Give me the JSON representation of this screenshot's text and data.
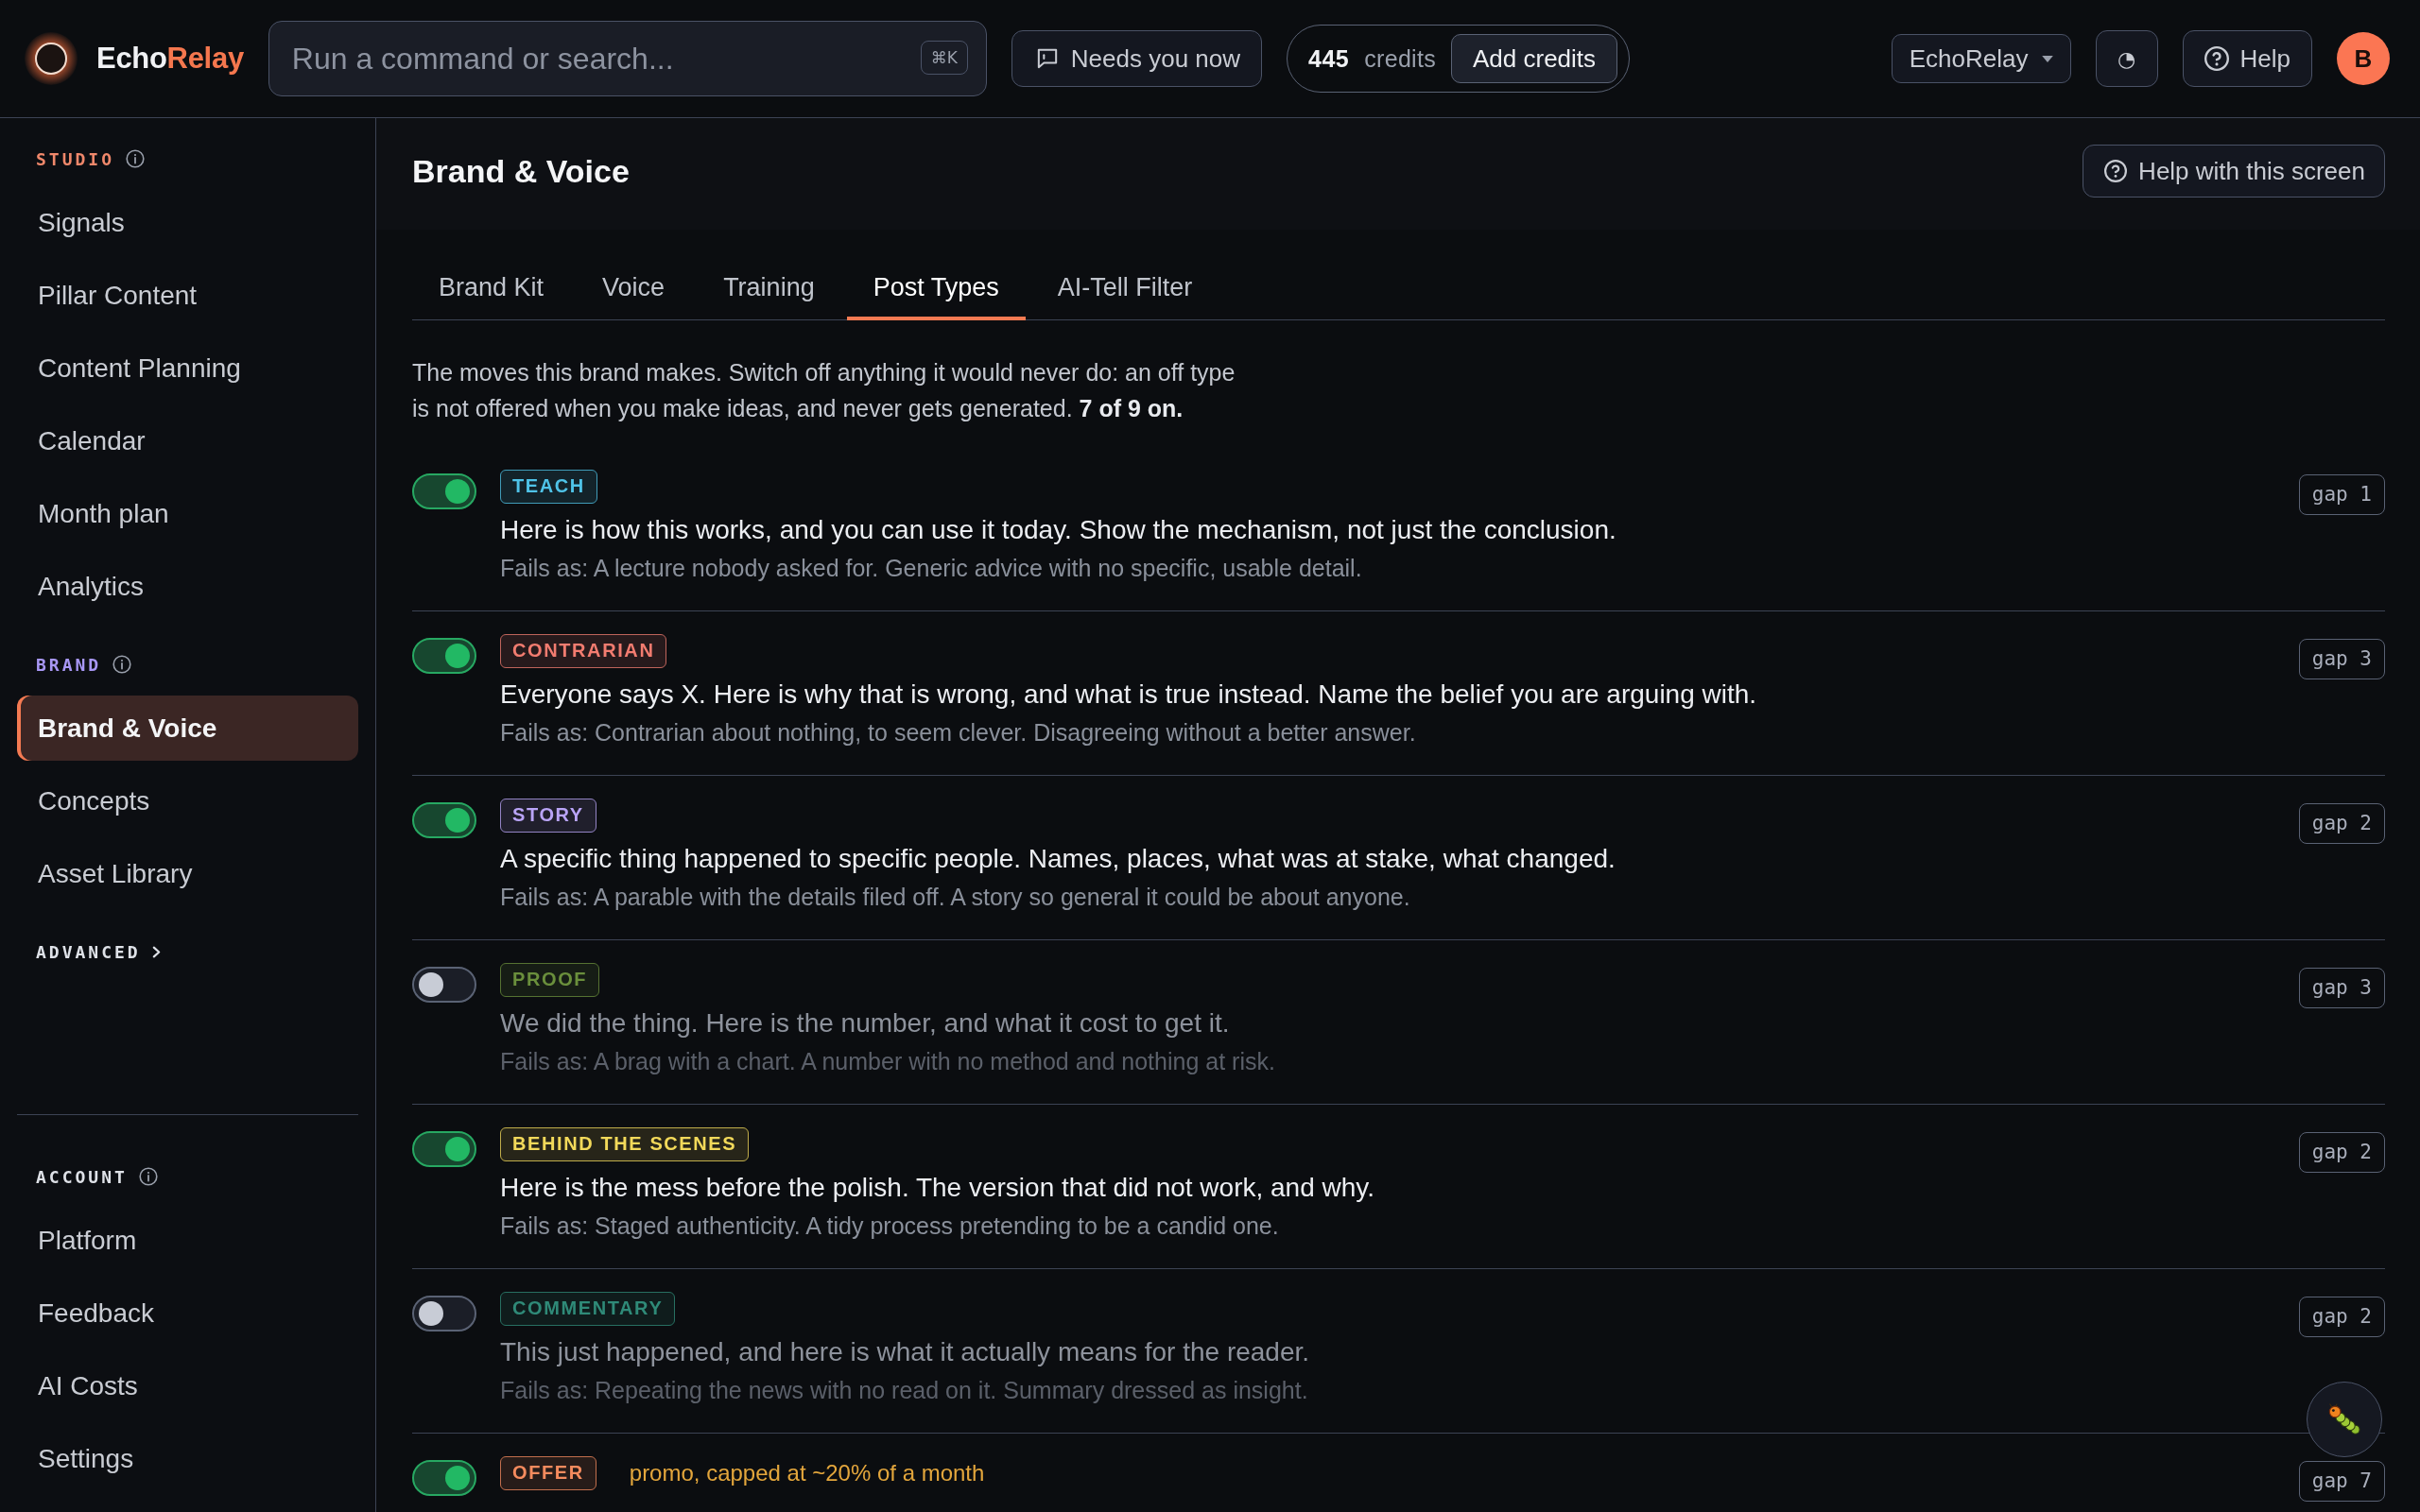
{
  "topbar": {
    "logo": {
      "name": "Echo",
      "accent": "Relay"
    },
    "search": {
      "placeholder": "Run a command or search...",
      "shortcut": "⌘K"
    },
    "needs_button": {
      "label": "Needs you now"
    },
    "credits": {
      "amount": "445",
      "unit": "credits",
      "button": "Add credits"
    },
    "workspace_select": {
      "value": "EchoRelay"
    },
    "theme_button": {
      "label": "◔"
    },
    "help_button": {
      "label": "Help"
    },
    "avatar": {
      "initial": "B"
    }
  },
  "sidebar": {
    "sections": [
      {
        "kind": "list",
        "title": "STUDIO",
        "color": "#f0886b",
        "items": [
          {
            "label": "Signals",
            "selected": false
          },
          {
            "label": "Pillar Content",
            "selected": false
          },
          {
            "label": "Content Planning",
            "selected": false
          },
          {
            "label": "Calendar",
            "selected": false
          },
          {
            "label": "Month plan",
            "selected": false
          },
          {
            "label": "Analytics",
            "selected": false
          }
        ]
      },
      {
        "kind": "list",
        "title": "BRAND",
        "color": "#a897f5",
        "items": [
          {
            "label": "Brand & Voice",
            "selected": true
          },
          {
            "label": "Concepts",
            "selected": false
          },
          {
            "label": "Asset Library",
            "selected": false
          }
        ]
      },
      {
        "kind": "collapsed",
        "title": "ADVANCED",
        "color": "#dfe2e8"
      }
    ],
    "footer_sections": [
      {
        "kind": "list",
        "title": "ACCOUNT",
        "color": "#dfe2e8",
        "items": [
          {
            "label": "Platform",
            "selected": false
          },
          {
            "label": "Feedback",
            "selected": false
          },
          {
            "label": "AI Costs",
            "selected": false
          },
          {
            "label": "Settings",
            "selected": false
          }
        ]
      }
    ]
  },
  "page": {
    "title": "Brand & Voice",
    "help_button": "Help with this screen"
  },
  "tabs": [
    {
      "label": "Brand Kit",
      "selected": false
    },
    {
      "label": "Voice",
      "selected": false
    },
    {
      "label": "Training",
      "selected": false
    },
    {
      "label": "Post Types",
      "selected": true
    },
    {
      "label": "AI-Tell Filter",
      "selected": false
    }
  ],
  "intro": "The moves this brand makes. Switch off anything it would never do: an off type is not offered when you make ideas, and never gets generated. **7 of 9 on.**",
  "post_types": [
    {
      "label": "TEACH",
      "color": "#4fc3e8",
      "on": true,
      "description": "Here is how this works, and you can use it today. Show the mechanism, not just the conclusion.",
      "fails": "Fails as: A lecture nobody asked for. Generic advice with no specific, usable detail.",
      "gap": "gap 1"
    },
    {
      "label": "CONTRARIAN",
      "color": "#f27c70",
      "on": true,
      "description": "Everyone says X. Here is why that is wrong, and what is true instead. Name the belief you are arguing with.",
      "fails": "Fails as: Contrarian about nothing, to seem clever. Disagreeing without a better answer.",
      "gap": "gap 3"
    },
    {
      "label": "STORY",
      "color": "#b9a4f7",
      "on": true,
      "description": "A specific thing happened to specific people. Names, places, what was at stake, what changed.",
      "fails": "Fails as: A parable with the details filed off. A story so general it could be about anyone.",
      "gap": "gap 2"
    },
    {
      "label": "PROOF",
      "color": "#6a8f3c",
      "on": false,
      "description": "We did the thing. Here is the number, and what it cost to get it.",
      "fails": "Fails as: A brag with a chart. A number with no method and nothing at risk.",
      "gap": "gap 3"
    },
    {
      "label": "BEHIND THE SCENES",
      "color": "#f2d95a",
      "on": true,
      "description": "Here is the mess before the polish. The version that did not work, and why.",
      "fails": "Fails as: Staged authenticity. A tidy process pretending to be a candid one.",
      "gap": "gap 2"
    },
    {
      "label": "COMMENTARY",
      "color": "#2f8a78",
      "on": false,
      "description": "This just happened, and here is what it actually means for the reader.",
      "fails": "Fails as: Repeating the news with no read on it. Summary dressed as insight.",
      "gap": "gap 2"
    },
    {
      "label": "OFFER",
      "color": "#f58b5e",
      "on": true,
      "note": "promo, capped at ~20% of a month",
      "gap": "gap 7"
    }
  ]
}
